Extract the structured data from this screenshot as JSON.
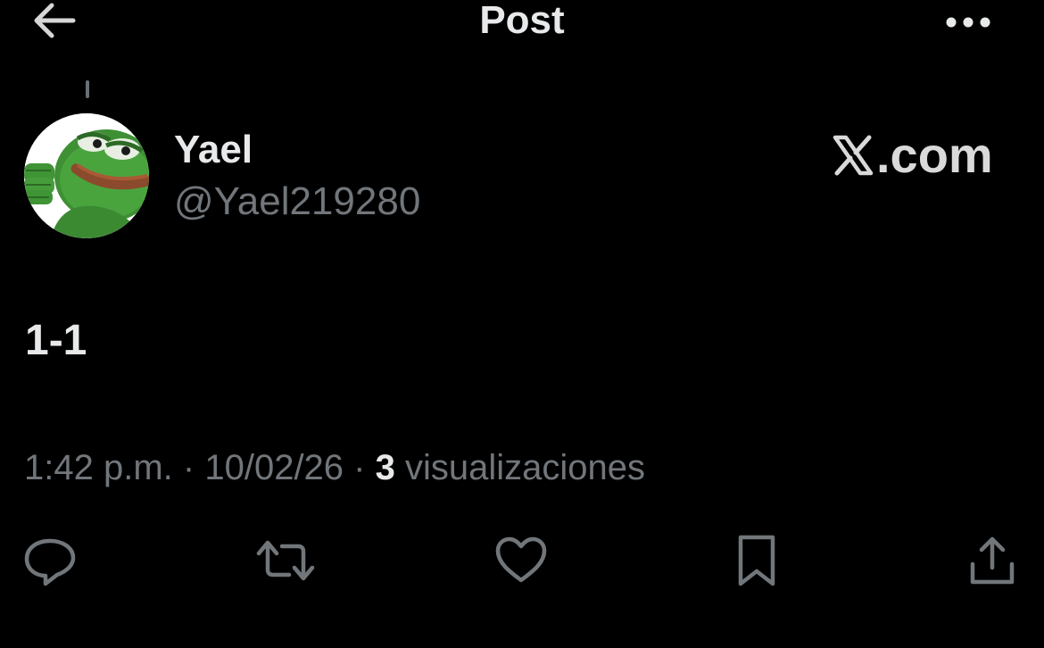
{
  "header": {
    "title": "Post",
    "back_icon": "arrow-left-icon",
    "more_icon": "more-horizontal-icon"
  },
  "post": {
    "author_name": "Yael",
    "author_handle": "@Yael219280",
    "watermark": ".com",
    "text": "1-1",
    "time": "1:42 p.m.",
    "date": "10/02/26",
    "views_count": "3",
    "views_label": "visualizaciones",
    "separator": "·"
  },
  "actions": [
    {
      "name": "reply",
      "icon": "reply-icon"
    },
    {
      "name": "repost",
      "icon": "repost-icon"
    },
    {
      "name": "like",
      "icon": "heart-icon"
    },
    {
      "name": "bookmark",
      "icon": "bookmark-icon"
    },
    {
      "name": "share",
      "icon": "share-icon"
    }
  ],
  "colors": {
    "background": "#000000",
    "primary_text": "#e7e9ea",
    "secondary_text": "#71767b",
    "icon": "#71767b"
  }
}
